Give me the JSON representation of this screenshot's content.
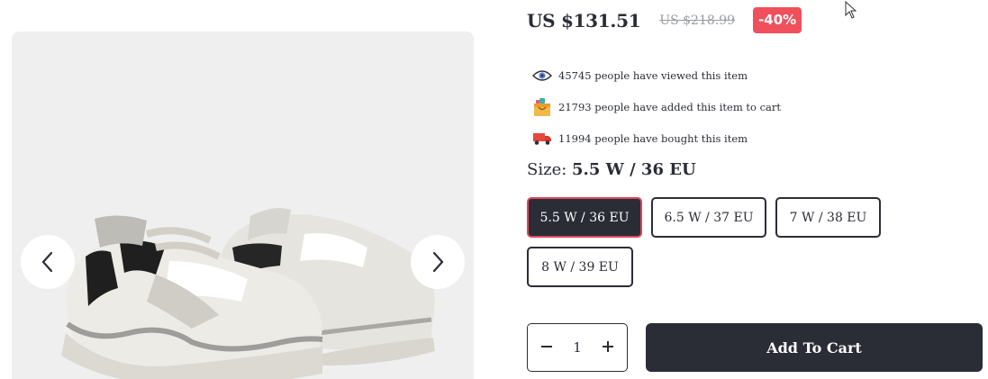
{
  "product": {
    "price_current": "US $131.51",
    "price_original": "US $218.99",
    "discount_badge": "-40%"
  },
  "stats": [
    {
      "icon": "eye-icon",
      "text": "45745 people have viewed this item"
    },
    {
      "icon": "cart-bag-icon",
      "text": "21793 people have added this item to cart"
    },
    {
      "icon": "truck-icon",
      "text": "11994 people have bought this item"
    }
  ],
  "size": {
    "label": "Size:",
    "selected_value": "5.5 W / 36 EU",
    "options": [
      "5.5 W / 36 EU",
      "6.5 W / 37 EU",
      "7 W / 38 EU",
      "8 W / 39 EU"
    ]
  },
  "quantity": {
    "minus_icon": "minus-icon",
    "plus_icon": "plus-icon",
    "value": "1"
  },
  "cart": {
    "label": "Add To Cart"
  },
  "gallery": {
    "prev_icon": "chevron-left-icon",
    "next_icon": "chevron-right-icon"
  },
  "colors": {
    "dark": "#2b2d36",
    "accent_red": "#f0505b",
    "gallery_bg": "#efefef"
  }
}
